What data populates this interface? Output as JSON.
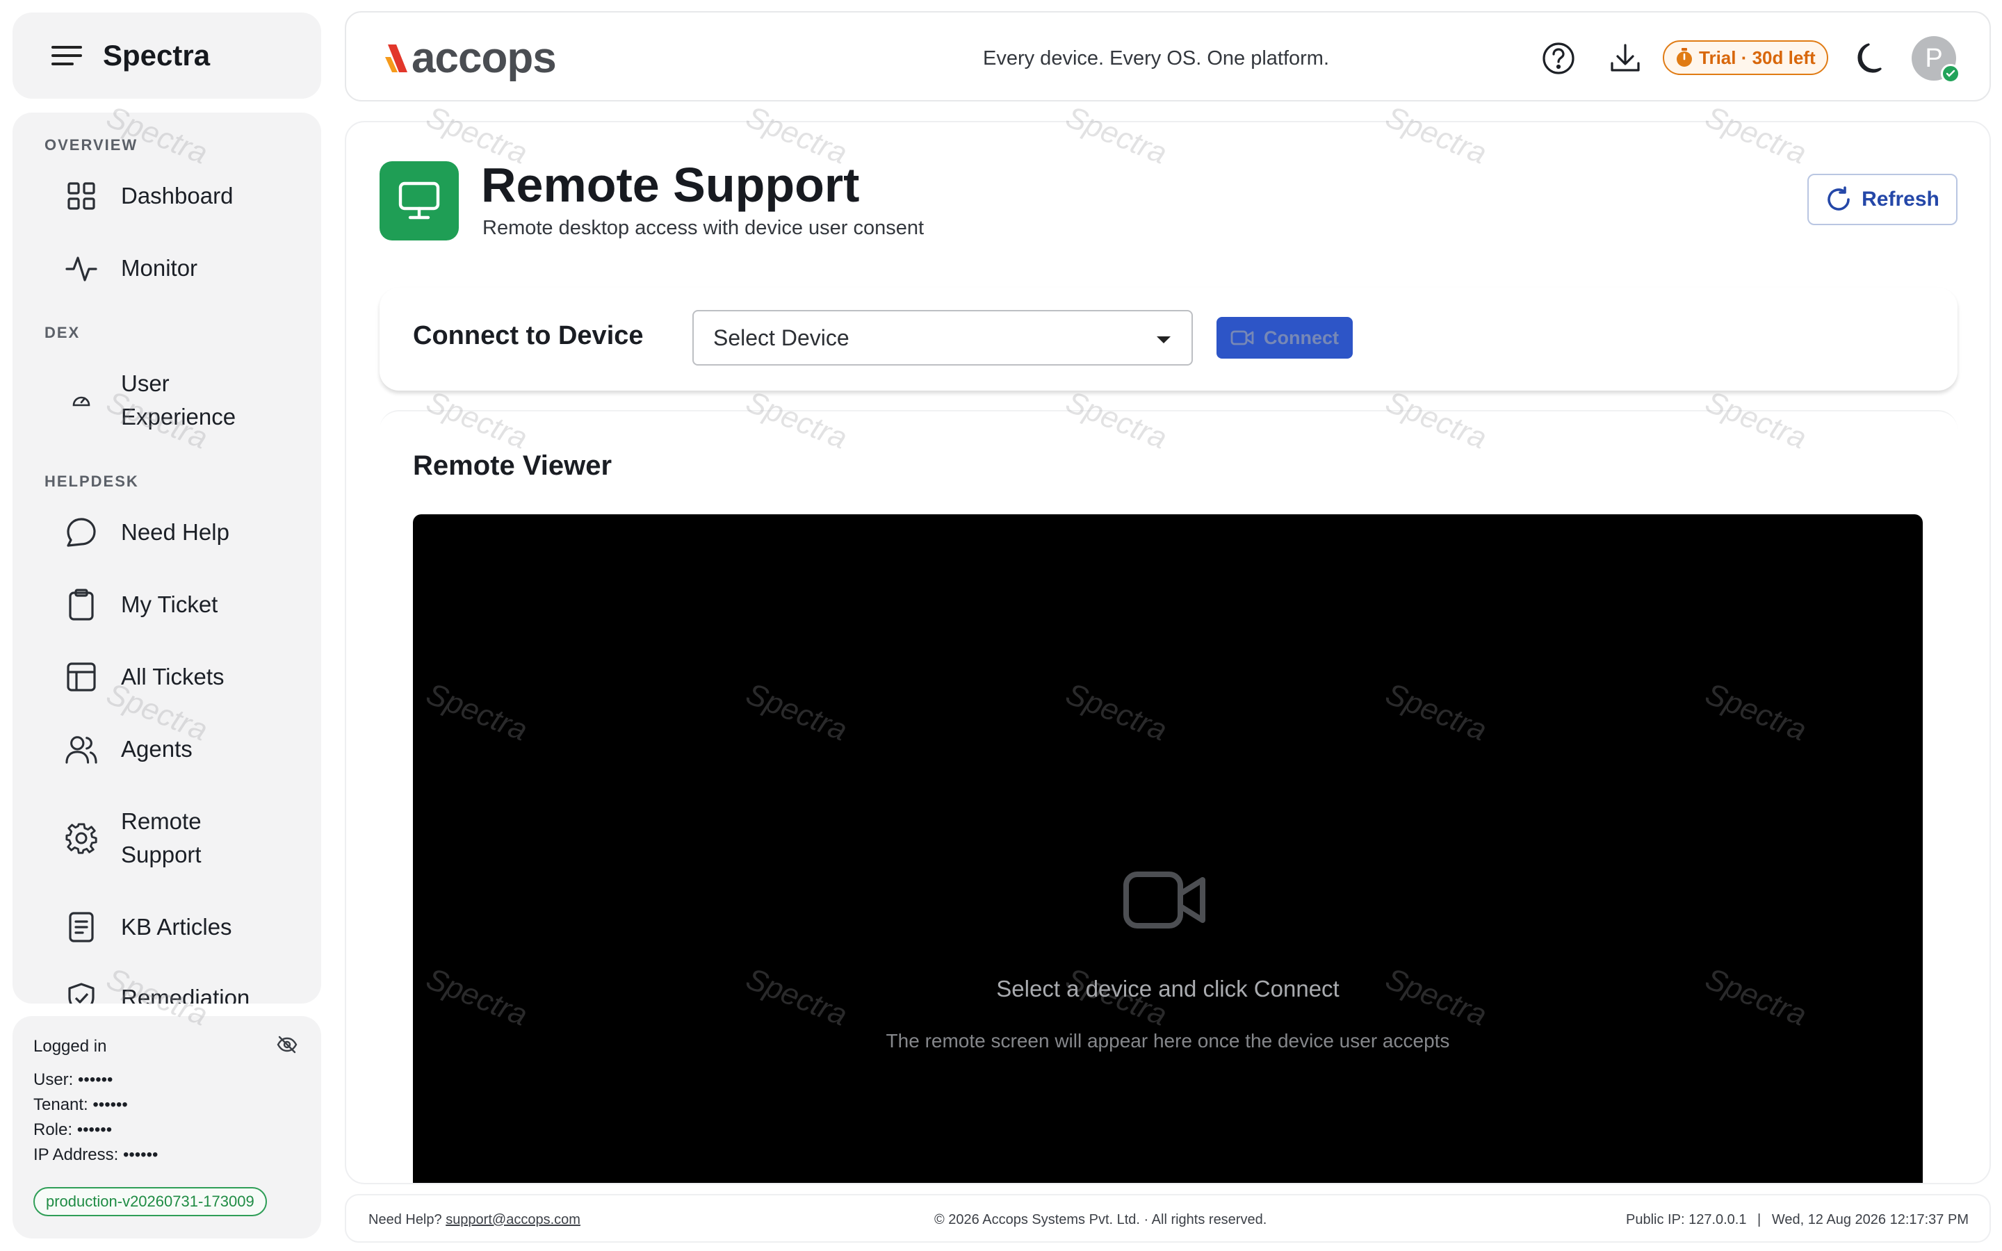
{
  "sidebar": {
    "brand": "Spectra",
    "sections": [
      {
        "title": "OVERVIEW"
      },
      {
        "title": "DEX"
      },
      {
        "title": "HELPDESK"
      }
    ],
    "items": [
      {
        "label": "Dashboard",
        "icon": "grid-icon"
      },
      {
        "label": "Monitor",
        "icon": "pulse-icon"
      },
      {
        "label": "User\nExperience",
        "icon": "gauge-icon"
      },
      {
        "label": "Need Help",
        "icon": "chat-icon"
      },
      {
        "label": "My Ticket",
        "icon": "clipboard-icon"
      },
      {
        "label": "All Tickets",
        "icon": "table-icon"
      },
      {
        "label": "Agents",
        "icon": "users-icon"
      },
      {
        "label": "Remote\nSupport",
        "icon": "gear-icon"
      },
      {
        "label": "KB Articles",
        "icon": "document-icon"
      },
      {
        "label": "Remediation",
        "icon": "shield-check-icon"
      }
    ],
    "session": {
      "title": "Logged in",
      "user": "User: ••••••",
      "tenant": "Tenant: ••••••",
      "role": "Role: ••••••",
      "ip": "IP Address: ••••••",
      "version": "production-v20260731-173009"
    }
  },
  "header": {
    "logo_text": "accops",
    "tagline": "Every device. Every OS. One platform.",
    "trial": "Trial · 30d left",
    "avatar_initial": "P"
  },
  "page": {
    "title": "Remote Support",
    "subtitle": "Remote desktop access with device user consent",
    "refresh_label": "Refresh"
  },
  "connect": {
    "label": "Connect to Device",
    "select_value": "Select Device",
    "button_label": "Connect"
  },
  "viewer": {
    "title": "Remote Viewer",
    "placeholder_title": "Select a device and click Connect",
    "placeholder_sub": "The remote screen will appear here once the device user accepts"
  },
  "footer": {
    "help_prefix": "Need Help?",
    "help_email": "support@accops.com",
    "copyright": "© 2026 Accops Systems Pvt. Ltd. · All rights reserved.",
    "public_ip": "Public IP: 127.0.0.1",
    "datetime": "Wed, 12 Aug 2026 12:17:37 PM"
  },
  "watermark_text": "Spectra",
  "colors": {
    "accent_green": "#1f9e55",
    "primary_blue": "#2d55c7",
    "trial_orange": "#d8670b"
  }
}
